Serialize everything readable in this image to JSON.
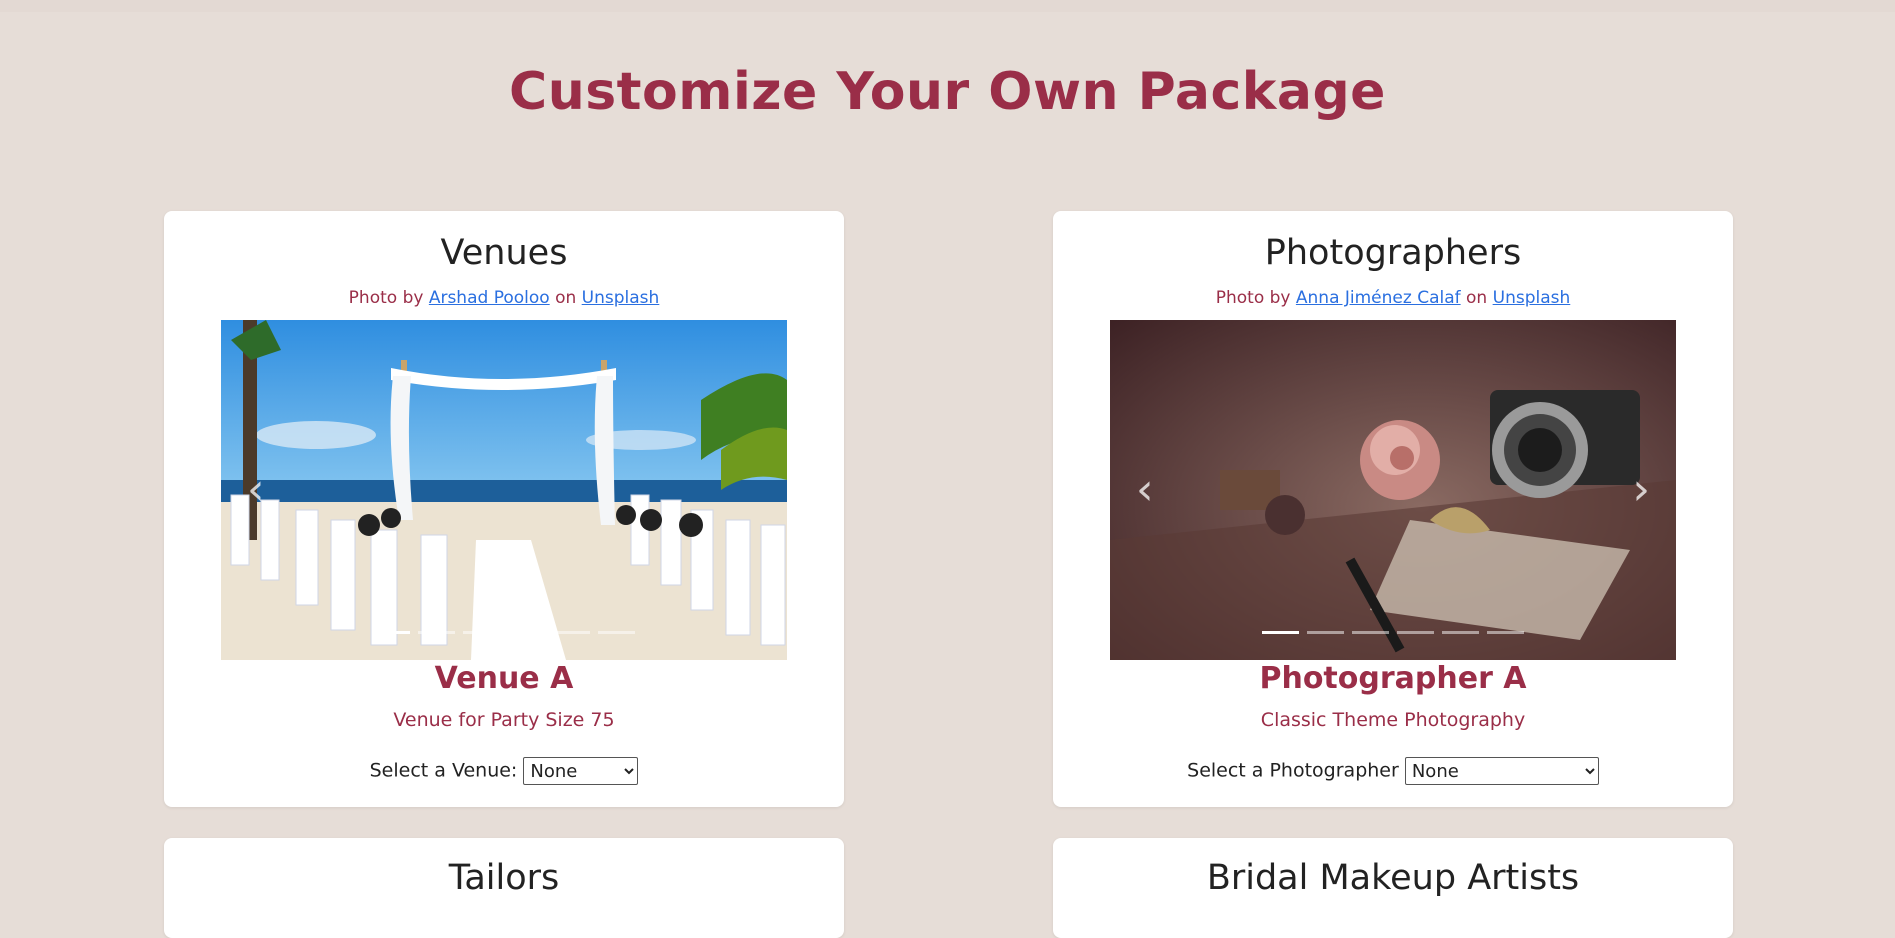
{
  "page": {
    "title": "Customize Your Own Package"
  },
  "venues": {
    "title": "Venues",
    "credit_prefix": "Photo by",
    "credit_author": "Arshad Pooloo",
    "credit_mid": "on",
    "credit_site": "Unsplash",
    "item_name": "Venue A",
    "item_desc": "Venue for Party Size 75",
    "select_label": "Select a Venue:",
    "select_value": "None",
    "slides": 6,
    "active_slide": 1
  },
  "photographers": {
    "title": "Photographers",
    "credit_prefix": "Photo by",
    "credit_author": "Anna Jiménez Calaf",
    "credit_mid": "on",
    "credit_site": "Unsplash",
    "item_name": "Photographer A",
    "item_desc": "Classic Theme Photography",
    "select_label": "Select a Photographer",
    "select_value": "None",
    "slides": 6,
    "active_slide": 1
  },
  "tailors": {
    "title": "Tailors"
  },
  "makeup": {
    "title": "Bridal Makeup Artists"
  },
  "icons": {
    "prev": "chevron-left-icon",
    "next": "chevron-right-icon"
  },
  "colors": {
    "accent": "#9a2e48",
    "background": "#e6ddd7",
    "link": "#2a6fe0"
  }
}
